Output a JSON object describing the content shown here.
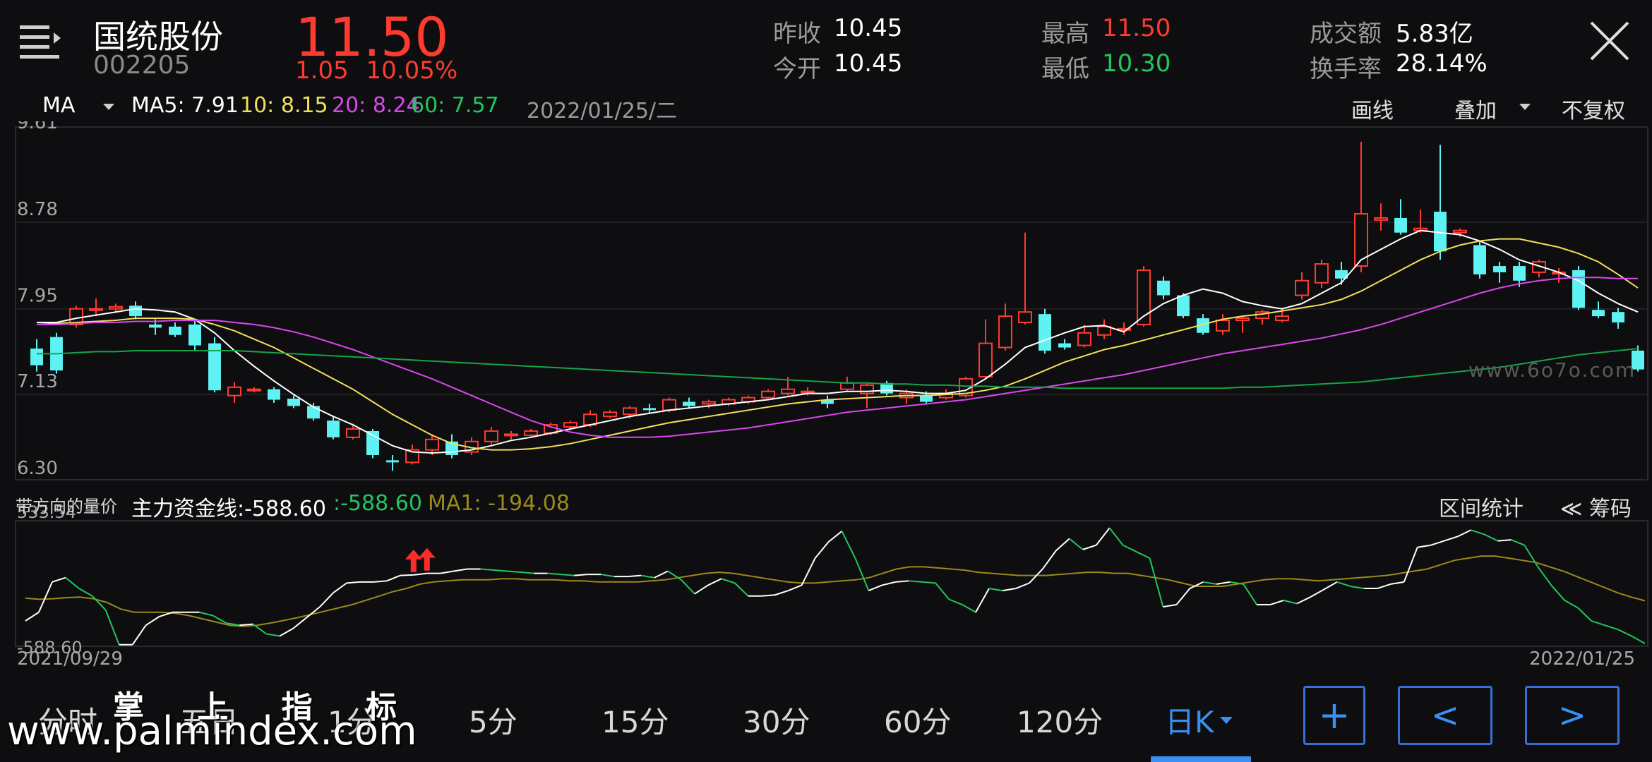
{
  "header": {
    "name": "国统股份",
    "code": "002205",
    "price": "11.50",
    "change": "1.05",
    "change_pct": "10.05%",
    "stats": [
      {
        "label": "昨收",
        "value": "10.45",
        "color": "#ffffff"
      },
      {
        "label": "今开",
        "value": "10.45",
        "color": "#ffffff"
      },
      {
        "label": "最高",
        "value": "11.50",
        "color": "#ff3b30"
      },
      {
        "label": "最低",
        "value": "10.30",
        "color": "#22c55e"
      },
      {
        "label": "成交额",
        "value": "5.83亿",
        "color": "#ffffff"
      },
      {
        "label": "换手率",
        "value": "28.14%",
        "color": "#ffffff"
      }
    ]
  },
  "toolbar": {
    "indicator": "MA",
    "ma5": "MA5: 7.91",
    "ma10": "10: 8.15",
    "ma20": "20: 8.24",
    "ma60": "60: 7.57",
    "date": "2022/01/25/二",
    "draw_label": "画线",
    "overlay_label": "叠加",
    "adjust_label": "不复权"
  },
  "chart_data": {
    "type": "candlestick",
    "price_ticks": [
      "9.61",
      "8.78",
      "7.95",
      "7.13",
      "6.30"
    ],
    "ylim": [
      6.3,
      9.61
    ],
    "start_date": "2021/09/29",
    "end_date": "2022/01/25",
    "candles": [
      [
        7.57,
        7.41,
        7.66,
        7.35
      ],
      [
        7.68,
        7.36,
        7.72,
        7.33
      ],
      [
        7.8,
        7.95,
        7.98,
        7.77
      ],
      [
        7.95,
        7.95,
        8.05,
        7.88
      ],
      [
        7.95,
        7.97,
        8.0,
        7.92
      ],
      [
        7.98,
        7.88,
        8.02,
        7.85
      ],
      [
        7.8,
        7.77,
        7.85,
        7.7
      ],
      [
        7.78,
        7.7,
        7.82,
        7.68
      ],
      [
        7.8,
        7.6,
        7.85,
        7.55
      ],
      [
        7.62,
        7.17,
        7.68,
        7.15
      ],
      [
        7.12,
        7.2,
        7.25,
        7.05
      ],
      [
        7.18,
        7.18,
        7.2,
        7.15
      ],
      [
        7.18,
        7.08,
        7.2,
        7.05
      ],
      [
        7.09,
        7.02,
        7.12,
        7.0
      ],
      [
        7.02,
        6.9,
        7.05,
        6.88
      ],
      [
        6.88,
        6.72,
        6.92,
        6.7
      ],
      [
        6.72,
        6.8,
        6.85,
        6.7
      ],
      [
        6.78,
        6.55,
        6.8,
        6.52
      ],
      [
        6.5,
        6.48,
        6.55,
        6.4
      ],
      [
        6.48,
        6.6,
        6.65,
        6.46
      ],
      [
        6.6,
        6.7,
        6.75,
        6.55
      ],
      [
        6.68,
        6.55,
        6.75,
        6.52
      ],
      [
        6.58,
        6.68,
        6.72,
        6.55
      ],
      [
        6.68,
        6.78,
        6.82,
        6.65
      ],
      [
        6.75,
        6.75,
        6.78,
        6.7
      ],
      [
        6.74,
        6.78,
        6.8,
        6.72
      ],
      [
        6.76,
        6.84,
        6.86,
        6.74
      ],
      [
        6.82,
        6.86,
        6.88,
        6.8
      ],
      [
        6.84,
        6.94,
        6.98,
        6.82
      ],
      [
        6.92,
        6.96,
        6.98,
        6.9
      ],
      [
        6.94,
        7.0,
        7.02,
        6.9
      ],
      [
        7.0,
        6.98,
        7.04,
        6.95
      ],
      [
        6.98,
        7.08,
        7.1,
        6.96
      ],
      [
        7.06,
        7.02,
        7.1,
        7.0
      ],
      [
        7.04,
        7.06,
        7.08,
        7.0
      ],
      [
        7.04,
        7.08,
        7.1,
        7.02
      ],
      [
        7.06,
        7.1,
        7.12,
        7.04
      ],
      [
        7.1,
        7.16,
        7.18,
        7.08
      ],
      [
        7.14,
        7.18,
        7.3,
        7.12
      ],
      [
        7.16,
        7.16,
        7.2,
        7.12
      ],
      [
        7.08,
        7.04,
        7.12,
        7.0
      ],
      [
        7.18,
        7.24,
        7.3,
        7.16
      ],
      [
        7.14,
        7.22,
        7.24,
        7.0
      ],
      [
        7.24,
        7.14,
        7.26,
        7.12
      ],
      [
        7.1,
        7.14,
        7.18,
        7.04
      ],
      [
        7.12,
        7.06,
        7.16,
        7.04
      ],
      [
        7.1,
        7.14,
        7.18,
        7.08
      ],
      [
        7.12,
        7.28,
        7.3,
        7.1
      ],
      [
        7.3,
        7.62,
        7.85,
        7.28
      ],
      [
        7.58,
        7.88,
        8.0,
        7.55
      ],
      [
        7.82,
        7.92,
        8.68,
        7.8
      ],
      [
        7.9,
        7.55,
        7.95,
        7.52
      ],
      [
        7.62,
        7.58,
        7.66,
        7.56
      ],
      [
        7.6,
        7.72,
        7.8,
        7.58
      ],
      [
        7.7,
        7.78,
        7.85,
        7.66
      ],
      [
        7.76,
        7.76,
        7.82,
        7.7
      ],
      [
        7.8,
        8.32,
        8.36,
        7.78
      ],
      [
        8.22,
        8.08,
        8.26,
        8.04
      ],
      [
        8.08,
        7.88,
        8.1,
        7.86
      ],
      [
        7.86,
        7.72,
        7.9,
        7.7
      ],
      [
        7.74,
        7.84,
        7.9,
        7.7
      ],
      [
        7.84,
        7.86,
        7.88,
        7.72
      ],
      [
        7.86,
        7.92,
        7.94,
        7.8
      ],
      [
        7.84,
        7.88,
        7.96,
        7.82
      ],
      [
        8.08,
        8.22,
        8.3,
        8.04
      ],
      [
        8.2,
        8.38,
        8.42,
        8.15
      ],
      [
        8.32,
        8.24,
        8.4,
        8.18
      ],
      [
        8.36,
        8.86,
        9.55,
        8.3
      ],
      [
        8.8,
        8.82,
        8.96,
        8.7
      ],
      [
        8.82,
        8.68,
        9.0,
        8.66
      ],
      [
        8.7,
        8.72,
        8.9,
        8.68
      ],
      [
        8.88,
        8.5,
        9.52,
        8.42
      ],
      [
        8.68,
        8.7,
        8.72,
        8.64
      ],
      [
        8.56,
        8.28,
        8.6,
        8.24
      ],
      [
        8.36,
        8.3,
        8.4,
        8.2
      ],
      [
        8.36,
        8.22,
        8.4,
        8.16
      ],
      [
        8.3,
        8.4,
        8.42,
        8.25
      ],
      [
        8.3,
        8.3,
        8.34,
        8.2
      ],
      [
        8.32,
        7.96,
        8.36,
        7.94
      ],
      [
        7.94,
        7.88,
        8.02,
        7.86
      ],
      [
        7.92,
        7.82,
        7.96,
        7.76
      ],
      [
        7.55,
        7.37,
        7.6,
        7.35
      ]
    ],
    "ma_series": [
      {
        "name": "MA5",
        "color": "#ffffff",
        "values": [
          7.82,
          7.82,
          7.86,
          7.89,
          7.92,
          7.95,
          7.94,
          7.92,
          7.85,
          7.72,
          7.55,
          7.4,
          7.26,
          7.13,
          7.01,
          6.92,
          6.84,
          6.74,
          6.64,
          6.58,
          6.57,
          6.58,
          6.6,
          6.64,
          6.69,
          6.72,
          6.76,
          6.8,
          6.84,
          6.88,
          6.92,
          6.95,
          6.98,
          7.0,
          7.02,
          7.04,
          7.06,
          7.08,
          7.11,
          7.14,
          7.14,
          7.16,
          7.16,
          7.17,
          7.16,
          7.14,
          7.14,
          7.17,
          7.28,
          7.42,
          7.58,
          7.65,
          7.72,
          7.78,
          7.79,
          7.73,
          7.88,
          8.0,
          8.08,
          8.14,
          8.1,
          8.02,
          7.98,
          7.95,
          8.0,
          8.1,
          8.2,
          8.42,
          8.52,
          8.62,
          8.7,
          8.68,
          8.66,
          8.6,
          8.52,
          8.42,
          8.36,
          8.3,
          8.22,
          8.1,
          8.0,
          7.92
        ]
      },
      {
        "name": "10",
        "color": "#f1e05a",
        "values": [
          7.8,
          7.81,
          7.82,
          7.83,
          7.84,
          7.86,
          7.86,
          7.86,
          7.85,
          7.8,
          7.74,
          7.66,
          7.58,
          7.48,
          7.38,
          7.28,
          7.18,
          7.06,
          6.94,
          6.84,
          6.74,
          6.66,
          6.62,
          6.6,
          6.6,
          6.61,
          6.63,
          6.66,
          6.7,
          6.74,
          6.78,
          6.82,
          6.86,
          6.89,
          6.92,
          6.95,
          6.98,
          7.01,
          7.04,
          7.06,
          7.08,
          7.09,
          7.1,
          7.11,
          7.12,
          7.12,
          7.13,
          7.14,
          7.17,
          7.21,
          7.28,
          7.36,
          7.44,
          7.5,
          7.56,
          7.6,
          7.65,
          7.7,
          7.75,
          7.8,
          7.85,
          7.88,
          7.9,
          7.93,
          7.96,
          7.99,
          8.04,
          8.12,
          8.22,
          8.32,
          8.42,
          8.5,
          8.56,
          8.6,
          8.62,
          8.62,
          8.58,
          8.54,
          8.48,
          8.4,
          8.28,
          8.15
        ]
      },
      {
        "name": "20",
        "color": "#d946ef",
        "values": [
          7.8,
          7.8,
          7.81,
          7.82,
          7.82,
          7.83,
          7.83,
          7.84,
          7.84,
          7.84,
          7.82,
          7.8,
          7.77,
          7.73,
          7.68,
          7.62,
          7.56,
          7.49,
          7.42,
          7.35,
          7.28,
          7.2,
          7.12,
          7.04,
          6.96,
          6.88,
          6.82,
          6.77,
          6.74,
          6.72,
          6.72,
          6.72,
          6.73,
          6.75,
          6.77,
          6.79,
          6.81,
          6.84,
          6.87,
          6.9,
          6.93,
          6.96,
          6.98,
          7.0,
          7.02,
          7.04,
          7.06,
          7.08,
          7.11,
          7.14,
          7.17,
          7.2,
          7.23,
          7.26,
          7.29,
          7.32,
          7.36,
          7.4,
          7.44,
          7.48,
          7.52,
          7.55,
          7.58,
          7.61,
          7.64,
          7.67,
          7.71,
          7.75,
          7.8,
          7.86,
          7.92,
          7.98,
          8.04,
          8.1,
          8.15,
          8.19,
          8.22,
          8.24,
          8.25,
          8.25,
          8.24,
          8.24
        ]
      },
      {
        "name": "60",
        "color": "#16a34a",
        "values": [
          7.52,
          7.52,
          7.53,
          7.54,
          7.54,
          7.55,
          7.55,
          7.55,
          7.55,
          7.55,
          7.55,
          7.54,
          7.53,
          7.52,
          7.51,
          7.5,
          7.49,
          7.48,
          7.47,
          7.46,
          7.45,
          7.44,
          7.43,
          7.42,
          7.41,
          7.4,
          7.39,
          7.38,
          7.37,
          7.36,
          7.35,
          7.34,
          7.33,
          7.32,
          7.31,
          7.3,
          7.29,
          7.28,
          7.27,
          7.26,
          7.25,
          7.24,
          7.24,
          7.23,
          7.23,
          7.22,
          7.22,
          7.21,
          7.21,
          7.2,
          7.2,
          7.2,
          7.19,
          7.19,
          7.19,
          7.19,
          7.19,
          7.19,
          7.19,
          7.19,
          7.19,
          7.2,
          7.2,
          7.21,
          7.22,
          7.23,
          7.24,
          7.25,
          7.27,
          7.29,
          7.31,
          7.33,
          7.35,
          7.37,
          7.39,
          7.42,
          7.45,
          7.48,
          7.51,
          7.53,
          7.55,
          7.57
        ]
      }
    ],
    "indicator": {
      "title": "带方向的量价",
      "main_label": "主力资金线:-588.60",
      "main_value": ":-588.60",
      "ma1_label": "MA1: -194.08",
      "ticks": [
        "533.54",
        "-588.60"
      ],
      "ylim": [
        -588.6,
        533.54
      ],
      "main_values": [
        -380,
        -300,
        -20,
        20,
        -80,
        -150,
        -280,
        -600,
        -600,
        -420,
        -340,
        -300,
        -300,
        -300,
        -330,
        -400,
        -420,
        -410,
        -500,
        -520,
        -450,
        -350,
        -250,
        -120,
        -30,
        -20,
        -20,
        -10,
        40,
        45,
        60,
        60,
        80,
        100,
        100,
        90,
        80,
        70,
        60,
        60,
        50,
        40,
        50,
        50,
        30,
        30,
        40,
        20,
        80,
        0,
        -130,
        -50,
        10,
        -30,
        -150,
        -150,
        -140,
        -100,
        -50,
        200,
        350,
        450,
        200,
        -100,
        -50,
        -20,
        -10,
        -20,
        -30,
        -180,
        -230,
        -300,
        -80,
        -100,
        -80,
        -30,
        100,
        270,
        380,
        280,
        320,
        480,
        320,
        260,
        200,
        -250,
        -230,
        -80,
        -20,
        -40,
        -20,
        -40,
        -230,
        -230,
        -190,
        -220,
        -160,
        -90,
        -20,
        -60,
        -80,
        -80,
        -40,
        -20,
        300,
        320,
        360,
        400,
        460,
        420,
        360,
        370,
        320,
        120,
        -50,
        -190,
        -260,
        -380,
        -420,
        -460,
        -520,
        -588.6
      ],
      "ma1_values": [
        -170,
        -180,
        -175,
        -165,
        -160,
        -175,
        -210,
        -270,
        -300,
        -300,
        -300,
        -310,
        -330,
        -360,
        -390,
        -420,
        -430,
        -420,
        -400,
        -375,
        -350,
        -320,
        -290,
        -260,
        -230,
        -190,
        -150,
        -110,
        -80,
        -40,
        -20,
        -10,
        0,
        0,
        0,
        10,
        10,
        0,
        0,
        0,
        -10,
        -10,
        -20,
        -20,
        -20,
        -20,
        -10,
        0,
        20,
        40,
        60,
        70,
        60,
        40,
        20,
        0,
        -20,
        -30,
        -30,
        -20,
        -10,
        0,
        20,
        60,
        100,
        120,
        120,
        110,
        100,
        90,
        70,
        60,
        50,
        40,
        40,
        40,
        50,
        60,
        70,
        70,
        60,
        60,
        40,
        20,
        0,
        -30,
        -60,
        -60,
        -60,
        -40,
        -20,
        0,
        10,
        10,
        0,
        -10,
        0,
        10,
        20,
        30,
        40,
        60,
        80,
        100,
        140,
        180,
        200,
        220,
        220,
        200,
        180,
        160,
        120,
        80,
        30,
        -20,
        -70,
        -120,
        -160,
        -194.08
      ],
      "arrows_at": [
        29,
        30
      ]
    }
  },
  "indicator_bar": {
    "range_stats": "区间统计",
    "chips": "≪ 筹码"
  },
  "site_watermark": "www.6o7o.com",
  "nav": {
    "items": [
      "分时",
      "五日",
      "1分",
      "5分",
      "15分",
      "30分",
      "60分",
      "120分",
      "日K"
    ],
    "active_index": 8,
    "plus_label": "+",
    "prev_label": "<",
    "next_label": ">"
  },
  "watermark": {
    "top": "掌 上 指 标",
    "bottom": "www.palmindex.com"
  },
  "colors": {
    "up": "#ff3b30",
    "down": "#5ef2f2",
    "accent": "#3a8ff0",
    "green_line": "#22c55e",
    "olive_line": "#9a8a1a"
  }
}
